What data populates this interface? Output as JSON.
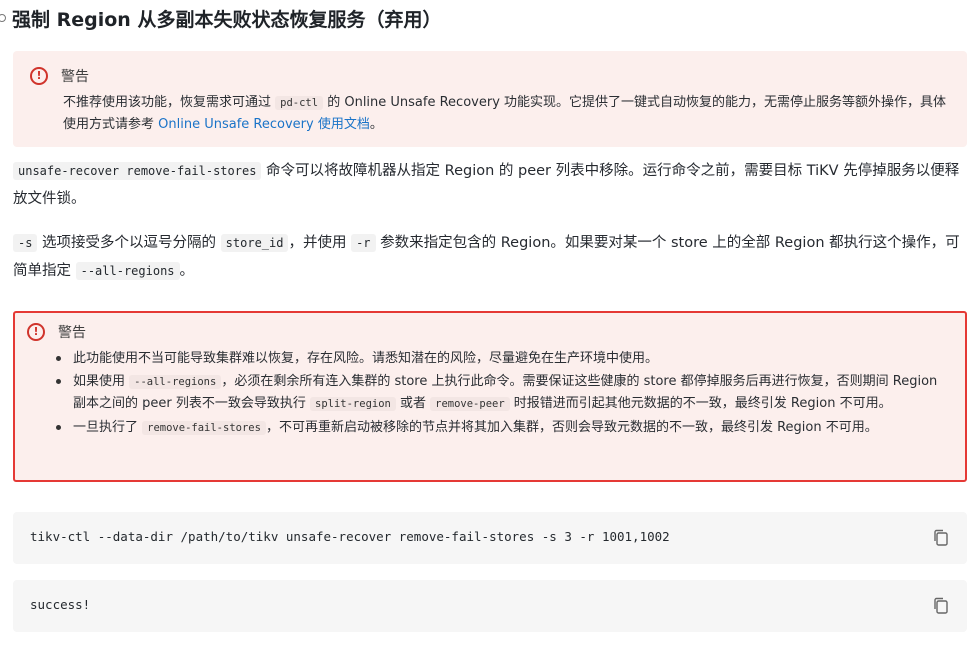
{
  "heading": "强制 Region 从多副本失败状态恢复服务（弃用）",
  "callout1": {
    "title": "警告",
    "text_a": "不推荐使用该功能，恢复需求可通过 ",
    "code": "pd-ctl",
    "text_b": " 的 Online Unsafe Recovery 功能实现。它提供了一键式自动恢复的能力，无需停止服务等额外操作，具体使用方式请参考 ",
    "link": "Online Unsafe Recovery 使用文档",
    "text_c": "。"
  },
  "para1": {
    "code": "unsafe-recover remove-fail-stores",
    "text": " 命令可以将故障机器从指定 Region 的 peer 列表中移除。运行命令之前，需要目标 TiKV 先停掉服务以便释放文件锁。"
  },
  "para2": {
    "code1": "-s",
    "text1": " 选项接受多个以逗号分隔的 ",
    "code2": "store_id",
    "text2": "，并使用 ",
    "code3": "-r",
    "text3": " 参数来指定包含的 Region。如果要对某一个 store 上的全部 Region 都执行这个操作，可简单指定 ",
    "code4": "--all-regions",
    "text4": "。"
  },
  "callout2": {
    "title": "警告",
    "item1": "此功能使用不当可能导致集群难以恢复，存在风险。请悉知潜在的风险，尽量避免在生产环境中使用。",
    "item2_a": "如果使用 ",
    "item2_code1": "--all-regions",
    "item2_b": "，必须在剩余所有连入集群的 store 上执行此命令。需要保证这些健康的 store 都停掉服务后再进行恢复，否则期间 Region 副本之间的 peer 列表不一致会导致执行 ",
    "item2_code2": "split-region",
    "item2_c": " 或者 ",
    "item2_code3": "remove-peer",
    "item2_d": " 时报错进而引起其他元数据的不一致，最终引发 Region 不可用。",
    "item3_a": "一旦执行了 ",
    "item3_code": "remove-fail-stores",
    "item3_b": "，不可再重新启动被移除的节点并将其加入集群，否则会导致元数据的不一致，最终引发 Region 不可用。"
  },
  "code_blocks": [
    {
      "code": "tikv-ctl --data-dir /path/to/tikv unsafe-recover remove-fail-stores -s 3 -r 1001,1002"
    },
    {
      "code": "success!"
    }
  ],
  "icons": {
    "warning": "warning-circle-icon",
    "copy": "copy-icon",
    "anchor": "anchor-icon"
  },
  "colors": {
    "callout_bg": "#fcefed",
    "warning_red": "#d0342c",
    "highlight_border": "#e53935",
    "link": "#1a73c8",
    "code_bg": "#f6f6f6"
  }
}
